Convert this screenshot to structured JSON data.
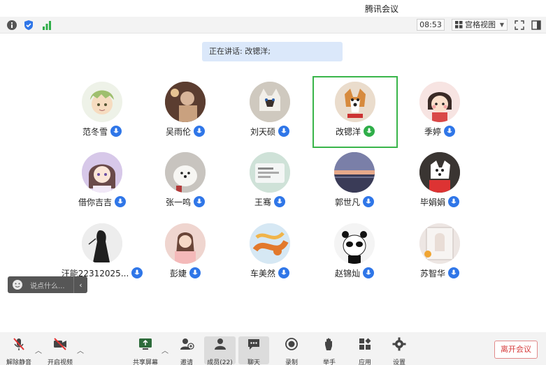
{
  "window": {
    "title": "腾讯会议"
  },
  "top_toolbar": {
    "time": "08:53",
    "view_mode": "宫格视图"
  },
  "speaking_banner": "正在讲话: 改锶洋;",
  "participants": [
    {
      "name": "范冬雪",
      "mic": "on"
    },
    {
      "name": "吴雨伦",
      "mic": "on"
    },
    {
      "name": "刘天硕",
      "mic": "on"
    },
    {
      "name": "改锶洋",
      "mic": "speaking"
    },
    {
      "name": "季婷",
      "mic": "on"
    },
    {
      "name": "借你吉吉",
      "mic": "on"
    },
    {
      "name": "张一鸣",
      "mic": "on"
    },
    {
      "name": "王骞",
      "mic": "on"
    },
    {
      "name": "郭世凡",
      "mic": "on"
    },
    {
      "name": "毕娟娟",
      "mic": "on"
    },
    {
      "name": "汪能22312025...",
      "mic": "on"
    },
    {
      "name": "彭婕",
      "mic": "on"
    },
    {
      "name": "车美然",
      "mic": "on"
    },
    {
      "name": "赵锦灿",
      "mic": "on"
    },
    {
      "name": "苏智华",
      "mic": "on"
    }
  ],
  "chat_input": {
    "placeholder": "说点什么..."
  },
  "bottom_toolbar": {
    "unmute": "解除静音",
    "start_video": "开启视频",
    "share_screen": "共享屏幕",
    "invite": "邀请",
    "members": "成员(22)",
    "chat": "聊天",
    "record": "录制",
    "raise_hand": "举手",
    "apps": "应用",
    "settings": "设置",
    "leave": "离开会议"
  },
  "colors": {
    "accent": "#2f76e8",
    "speaking": "#39b54a",
    "leave": "#d63a3a"
  }
}
